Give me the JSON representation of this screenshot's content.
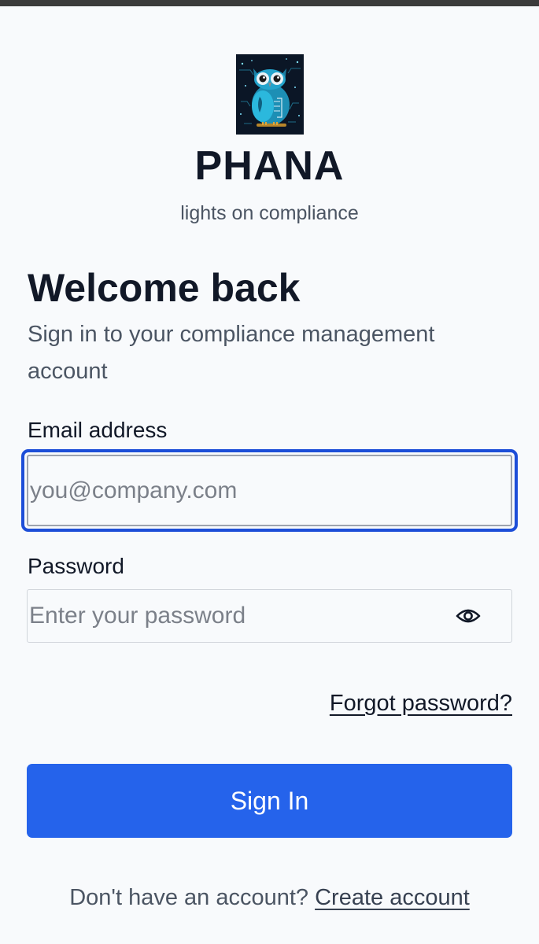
{
  "brand": {
    "logo_icon": "owl-logo-icon",
    "name": "PHANA",
    "tagline": "lights on compliance"
  },
  "main": {
    "heading": "Welcome back",
    "subheading": "Sign in to your compliance management account"
  },
  "form": {
    "email_label": "Email address",
    "email_placeholder": "you@company.com",
    "email_value": "",
    "password_label": "Password",
    "password_placeholder": "Enter your password",
    "password_value": "",
    "show_password_icon": "eye-icon",
    "forgot_link": "Forgot password?",
    "submit_label": "Sign In"
  },
  "footer": {
    "prompt": "Don't have an account?",
    "create_link": "Create account"
  },
  "colors": {
    "accent": "#2563eb",
    "focus_ring": "#1d4ed8",
    "background": "#f8fafc",
    "text_primary": "#111827",
    "text_secondary": "#4b5563"
  }
}
